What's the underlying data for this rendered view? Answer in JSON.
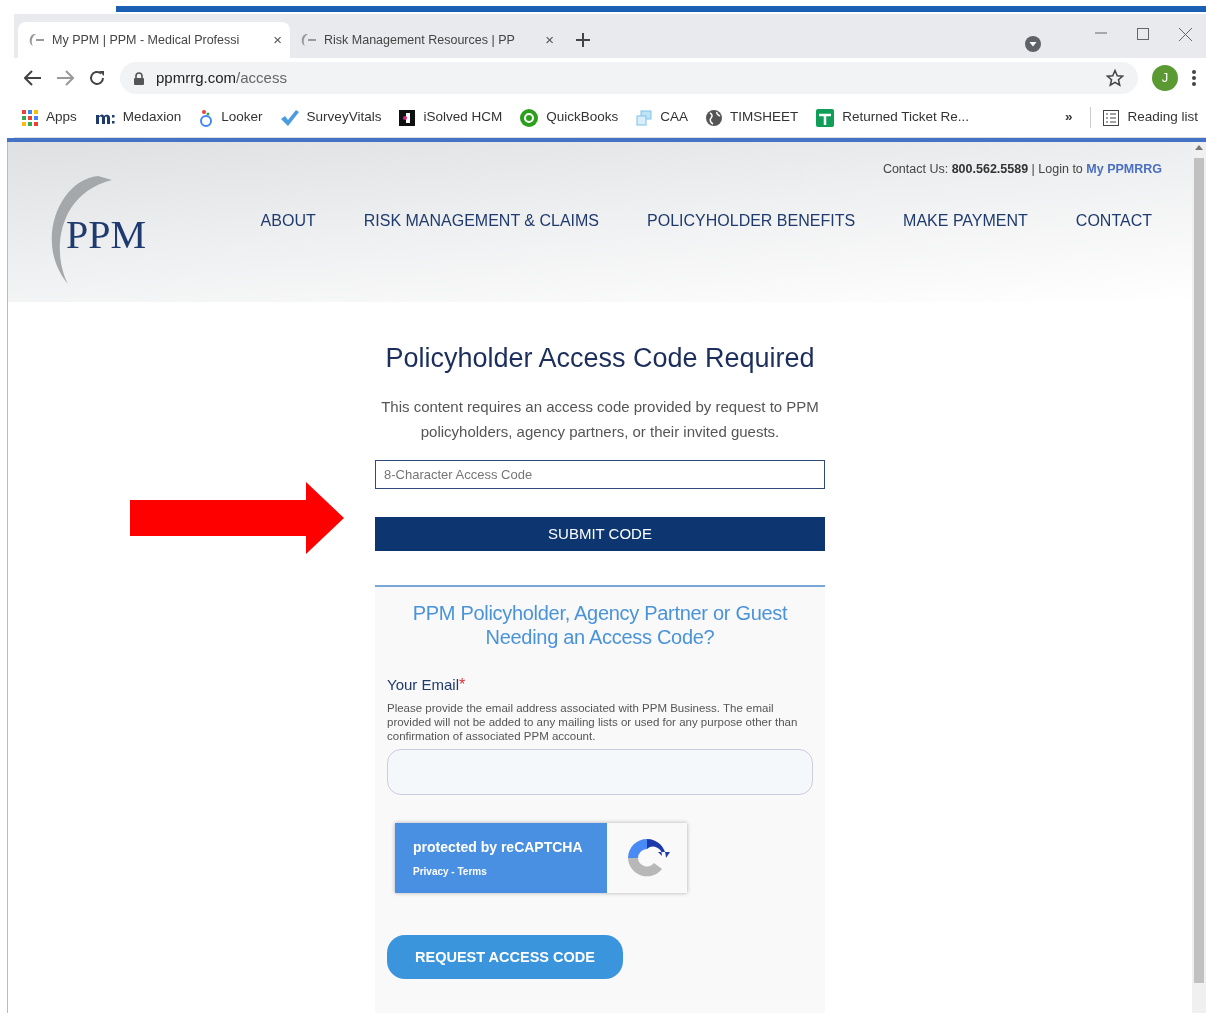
{
  "browser": {
    "tabs": [
      {
        "title": "My PPM | PPM - Medical Professi",
        "close": "×",
        "selected": true
      },
      {
        "title": "Risk Management Resources | PP",
        "close": "×",
        "selected": false
      }
    ],
    "url_host": "ppmrrg.com",
    "url_path": "/access",
    "profile_initial": "J",
    "bookmarks": [
      {
        "label": "Apps"
      },
      {
        "label": "Medaxion"
      },
      {
        "label": "Looker"
      },
      {
        "label": "SurveyVitals"
      },
      {
        "label": "iSolved HCM"
      },
      {
        "label": "QuickBooks"
      },
      {
        "label": "CAA"
      },
      {
        "label": "TIMSHEET"
      },
      {
        "label": "Returned Ticket Re..."
      }
    ],
    "overflow": "»",
    "reading_list": "Reading list"
  },
  "site": {
    "logo": "PPM",
    "contact": "Contact Us: **800.562.5589** | Login to",
    "login_link": "My PPMRRG",
    "nav": [
      "ABOUT",
      "RISK MANAGEMENT & CLAIMS",
      "POLICYHOLDER BENEFITS",
      "MAKE PAYMENT",
      "CONTACT"
    ]
  },
  "access": {
    "title": "Policyholder Access Code Required",
    "description": "This content requires an access code provided by request to PPM policyholders, agency partners, or their invited guests.",
    "placeholder": "8-Character Access Code",
    "submit": "SUBMIT CODE"
  },
  "request": {
    "title": "PPM Policyholder, Agency Partner or Guest Needing an Access Code?",
    "email_label": "Your Email",
    "required_mark": "*",
    "help": "Please provide the email address associated with PPM Business. The email provided will not be added to any mailing lists or used for any purpose other than confirmation of associated PPM account.",
    "recaptcha": "protected by reCAPTCHA",
    "recaptcha_links": "Privacy - Terms",
    "button": "REQUEST ACCESS CODE"
  }
}
